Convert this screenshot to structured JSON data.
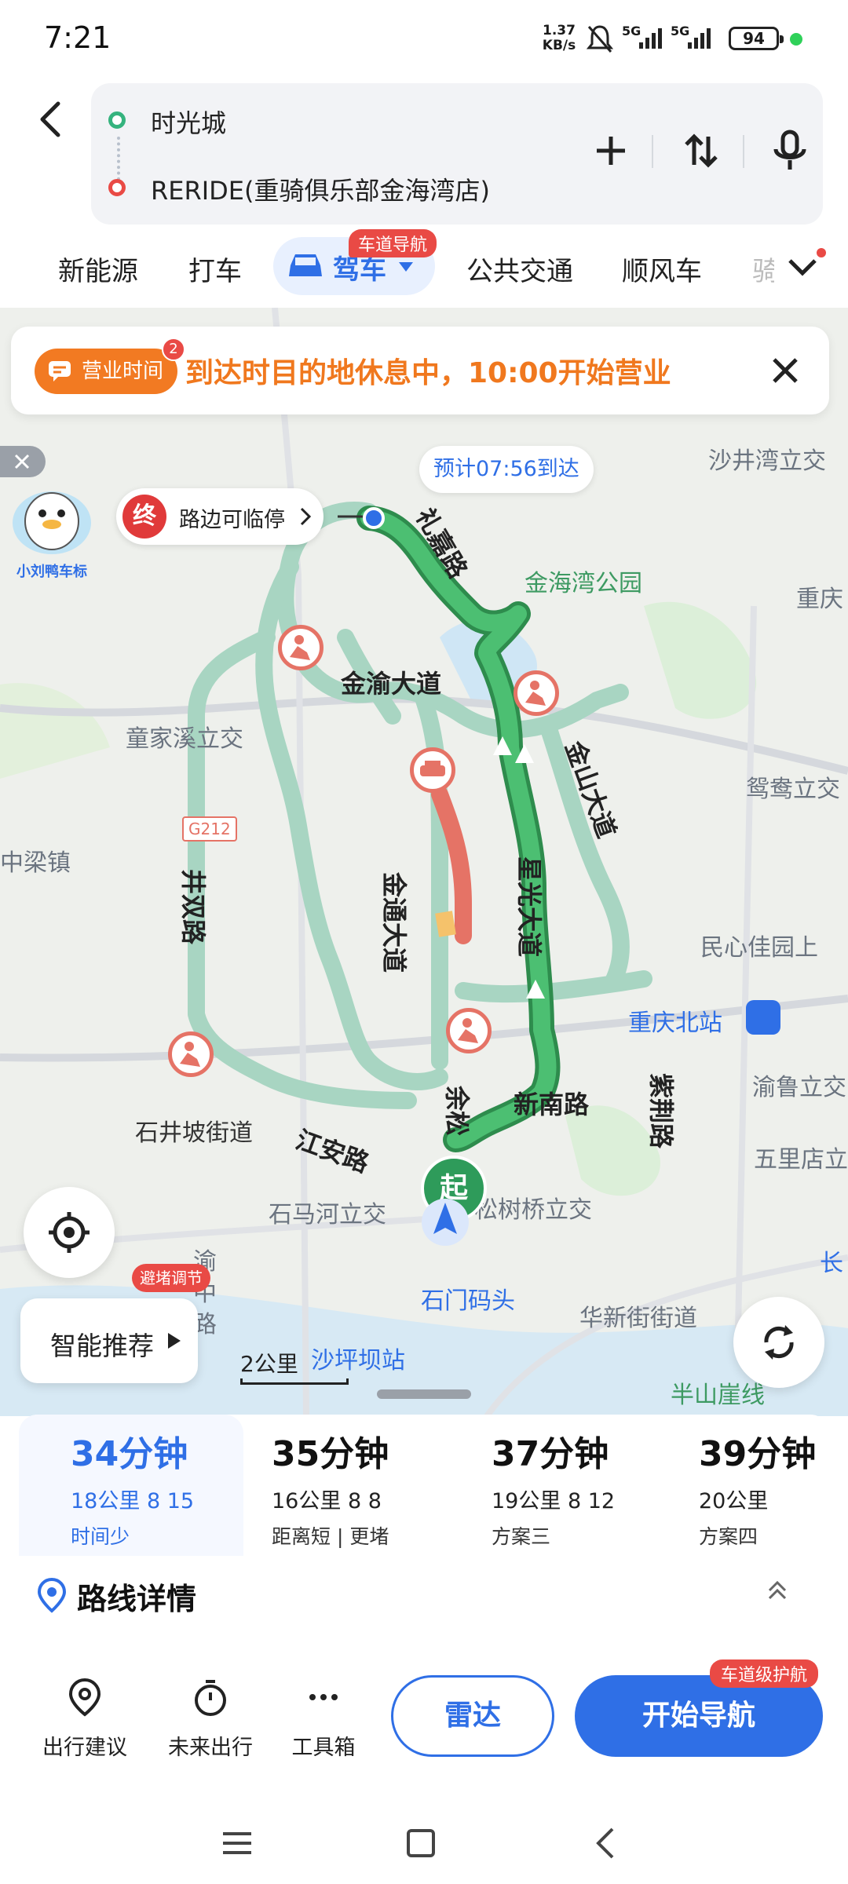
{
  "status_bar": {
    "time": "7:21",
    "net_speed": "1.37",
    "net_unit": "KB/s",
    "sig1": "5G",
    "sig2": "5G",
    "battery": "94"
  },
  "route": {
    "from": "时光城",
    "to": "RERIDE(重骑俱乐部金海湾店)"
  },
  "tabs": {
    "new_energy": "新能源",
    "taxi": "打车",
    "drive": "驾车",
    "drive_badge": "车道导航",
    "transit": "公共交通",
    "ride": "顺风车",
    "more": "骑"
  },
  "notice": {
    "chip": "营业时间",
    "chip_count": "2",
    "message": "到达时目的地休息中，10:00开始营业"
  },
  "map": {
    "eta": "预计07:56到达",
    "end_marker": "终",
    "end_label": "路边可临停",
    "start_marker": "起",
    "avoid": "避堵调节",
    "scale": "2公里",
    "mascot_label": "小刘鸭车标",
    "road_g212": "G212",
    "places": {
      "shajingwan": "沙井湾立交",
      "jinhaiwan": "金海湾公园",
      "chongqing_top": "重庆",
      "tongjiaxi": "童家溪立交",
      "yuanyang": "鸳鸯立交",
      "zhongliang": "中梁镇",
      "minxin": "民心佳园上",
      "cq_north": "重庆北站",
      "yulu": "渝鲁立交",
      "shijingpo": "石井坡街道",
      "wulidian": "五里店立",
      "shimahe": "石马河立交",
      "songshuqiao": "松树桥立交",
      "shimenmatou": "石门码头",
      "huaxinjie": "华新街街道",
      "shapingba": "沙坪坝站",
      "banshan": "半山崖线",
      "yu": "渝",
      "zhong": "中",
      "lu": "路",
      "chang": "长"
    },
    "roads": {
      "lizui": "礼嘉路",
      "jinyu": "金渝大道",
      "jinshan": "金山大道",
      "xingguang": "星光大道",
      "jintong": "金通大道",
      "jingshuang": "井双路",
      "yusong": "余松",
      "xinnan": "新南路",
      "zijing": "紫荆路",
      "jiangan": "江安路"
    }
  },
  "recommend": "智能推荐",
  "options": [
    {
      "time": "34分钟",
      "detail": "18公里  8 15",
      "note": "时间少"
    },
    {
      "time": "35分钟",
      "detail": "16公里  8 8",
      "note": "距离短 | 更堵"
    },
    {
      "time": "37分钟",
      "detail": "19公里  8 12",
      "note": "方案三"
    },
    {
      "time": "39分钟",
      "detail": "20公里",
      "note": "方案四"
    }
  ],
  "route_details": "路线详情",
  "actions": {
    "travel_tips": "出行建议",
    "future": "未来出行",
    "toolbox": "工具箱",
    "radar": "雷达",
    "start": "开始导航",
    "start_badge": "车道级护航"
  },
  "colors": {
    "accent": "#2f6fe6",
    "route_green": "#33a85a",
    "alt_route": "#a8d5c2",
    "congestion": "#e57366",
    "notice_orange": "#f0781e"
  }
}
